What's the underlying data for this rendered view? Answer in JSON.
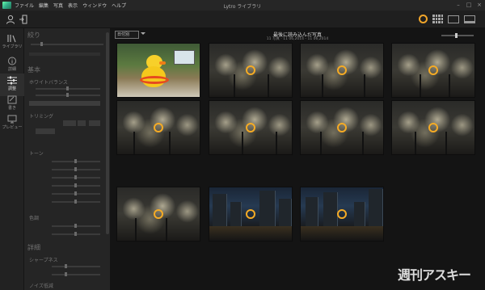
{
  "menubar": {
    "items": [
      "ファイル",
      "編集",
      "写真",
      "表示",
      "ウィンドウ",
      "ヘルプ"
    ],
    "window_title": "Lytro ライブラリ",
    "controls": [
      "–",
      "□",
      "×"
    ]
  },
  "rail": {
    "items": [
      {
        "label": "ライブラリ",
        "icon": "library-icon",
        "active": false
      },
      {
        "label": "詳細",
        "icon": "info-icon",
        "active": false
      },
      {
        "label": "調整",
        "icon": "adjust-sliders-icon",
        "active": true
      },
      {
        "label": "書き",
        "icon": "edit-icon",
        "active": false
      },
      {
        "label": "プレビュー",
        "icon": "preview-icon",
        "active": false
      }
    ]
  },
  "panel": {
    "aperture_head": "絞り",
    "basic_head": "基本",
    "white_balance": "ホワイトバランス",
    "trimming": "トリミング",
    "tone": "トーン",
    "color": "色調",
    "detail_head": "詳細",
    "sharpness": "シャープネス",
    "noise": "ノイズ低減"
  },
  "main": {
    "sort_value": "日付別",
    "library_title": "最後に読み込んだ写真",
    "library_subtitle": "11 写真 · 11 06,2014 - 11 06,2014"
  },
  "thumbnails": [
    {
      "kind": "duck"
    },
    {
      "kind": "trees"
    },
    {
      "kind": "trees"
    },
    {
      "kind": "trees"
    },
    {
      "kind": "trees"
    },
    {
      "kind": "trees"
    },
    {
      "kind": "trees"
    },
    {
      "kind": "trees"
    },
    {
      "kind": "trees"
    },
    {
      "kind": "night"
    },
    {
      "kind": "night"
    }
  ],
  "watermark": "週刊アスキー",
  "colors": {
    "accent": "#f5ab25",
    "background": "#141414",
    "panel": "#252525"
  }
}
